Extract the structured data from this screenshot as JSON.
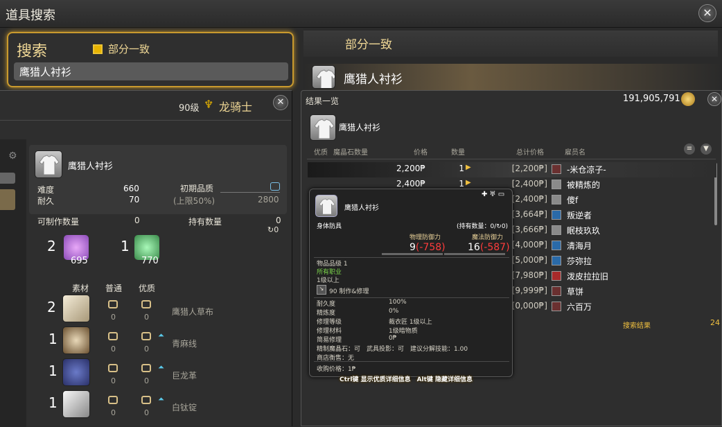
{
  "window": {
    "title": "道具搜索"
  },
  "search": {
    "label": "搜索",
    "partial_label": "部分一致",
    "query": "鹰猎人衬衫"
  },
  "craft": {
    "level": "90级",
    "job": "龙骑士",
    "item_name": "鹰猎人衬衫",
    "difficulty_label": "难度",
    "difficulty": "660",
    "durability_label": "耐久",
    "durability": "70",
    "init_quality_label": "初期品质",
    "init_quality_sub": "(上限50%)",
    "init_quality_max": "2800",
    "craftable_label": "可制作数量",
    "craftable": "0",
    "owned_label": "持有数量",
    "owned": "0",
    "owned_sub": "0",
    "crystals": [
      {
        "need": "2",
        "have": "695"
      },
      {
        "need": "1",
        "have": "770"
      }
    ],
    "mat_headers": {
      "material": "素材",
      "normal": "普通",
      "hq": "优质"
    },
    "materials": [
      {
        "need": "2",
        "name": "鹰猎人草布",
        "normal": "0",
        "hq": "0"
      },
      {
        "need": "1",
        "name": "青麻线",
        "normal": "0",
        "hq": "0"
      },
      {
        "need": "1",
        "name": "巨龙革",
        "normal": "0",
        "hq": "0"
      },
      {
        "need": "1",
        "name": "白钛锭",
        "normal": "0",
        "hq": "0"
      }
    ]
  },
  "results_header": {
    "mode": "部分一致",
    "item_name": "鹰猎人衬衫"
  },
  "market": {
    "title": "结果一览",
    "gil": "191,905,791",
    "item_name": "鹰猎人衬衫",
    "columns": [
      "优质",
      "魔晶石数量",
      "价格",
      "数量",
      "总计价格",
      "雇员名"
    ],
    "rows": [
      {
        "price": "2,200₱",
        "qty": "1",
        "total": "[2,200₱]",
        "seller": "-米仓凉子-"
      },
      {
        "price": "2,400₱",
        "qty": "1",
        "total": "[2,400₱]",
        "seller": "被精炼的"
      },
      {
        "price": "",
        "qty": "",
        "total": "[2,400₱]",
        "seller": "傻f"
      },
      {
        "price": "",
        "qty": "",
        "total": "[3,664₱]",
        "seller": "叛逆者"
      },
      {
        "price": "",
        "qty": "",
        "total": "[3,666₱]",
        "seller": "眠枝玖玖"
      },
      {
        "price": "",
        "qty": "",
        "total": "[4,000₱]",
        "seller": "清海月"
      },
      {
        "price": "",
        "qty": "",
        "total": "[5,000₱]",
        "seller": "莎弥拉"
      },
      {
        "price": "",
        "qty": "",
        "total": "[7,980₱]",
        "seller": "泼皮拉拉旧"
      },
      {
        "price": "",
        "qty": "",
        "total": "[9,999₱]",
        "seller": "草饼"
      },
      {
        "price": "",
        "qty": "",
        "total": "[0,000₱]",
        "seller": "六百万"
      }
    ],
    "footer_label": "搜索结果",
    "footer_count": "24"
  },
  "tooltip": {
    "name": "鹰猎人衬衫",
    "category": "身体防具",
    "owned": "(持有数量：0/",
    "owned_tail": "0)",
    "phys_label": "物理防御力",
    "phys_val": "9",
    "phys_diff": "(-758)",
    "mag_label": "魔法防御力",
    "mag_val": "16",
    "mag_diff": "(-587)",
    "ilvl": "物品品级 1",
    "jobs": "所有职业",
    "lvl": "1级以上",
    "craft_line": "90 制作&修理",
    "stats": [
      {
        "k": "耐久度",
        "v": "100%"
      },
      {
        "k": "精炼度",
        "v": "0%"
      },
      {
        "k": "修理等级",
        "v": "裁衣匠 1级以上"
      },
      {
        "k": "修理材料",
        "v": "1级暗物质"
      },
      {
        "k": "简易修理",
        "v": "0₱"
      }
    ],
    "meld_line": "精制魔晶石：可　武具投影：可　建议分解技能：1.00",
    "shop_line": "商店衡售：无",
    "buy_line": "收购价格：1₱",
    "hint": "Ctrl键 显示优质详细信息　Alt键 隐藏详细信息"
  }
}
